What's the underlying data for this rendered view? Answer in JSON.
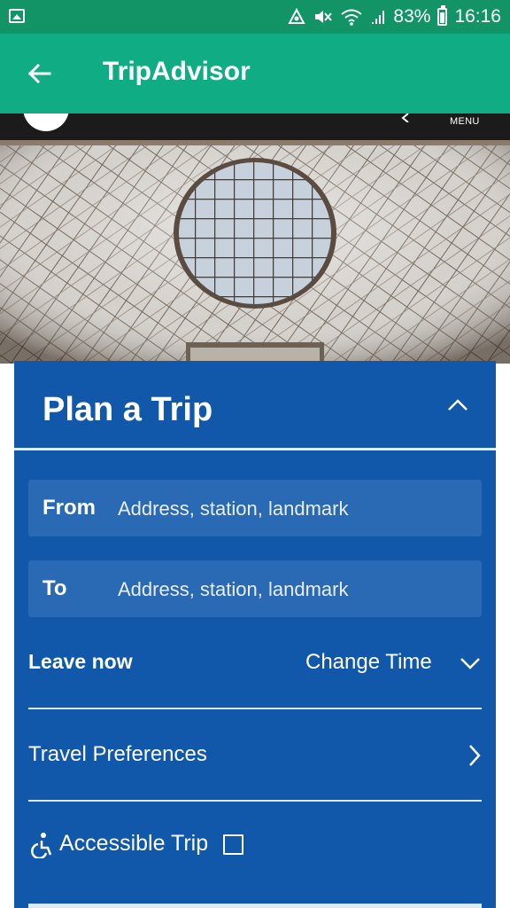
{
  "status_bar": {
    "battery": "83%",
    "time": "16:16"
  },
  "app_bar": {
    "title": "TripAdvisor"
  },
  "site_header": {
    "menu_label": "MENU"
  },
  "plan_trip": {
    "title": "Plan a Trip",
    "from": {
      "label": "From",
      "placeholder": "Address, station, landmark"
    },
    "to": {
      "label": "To",
      "placeholder": "Address, station, landmark"
    },
    "leave_label": "Leave now",
    "change_time_label": "Change Time",
    "travel_preferences_label": "Travel Preferences",
    "accessible_trip_label": "Accessible Trip",
    "accessible_trip_checked": false
  },
  "icons": {
    "status_left": "image-icon",
    "nfc": "nfc-icon",
    "mute": "mute-icon",
    "wifi": "wifi-icon",
    "signal": "signal-icon",
    "battery": "battery-icon",
    "back": "arrow-back-icon",
    "collapse": "chevron-up-icon",
    "change_time": "chevron-down-icon",
    "preferences": "chevron-right-icon",
    "accessible": "wheelchair-icon"
  },
  "colors": {
    "status_bar": "#129467",
    "app_bar": "#10ac84",
    "card": "#1158aa",
    "field": "#2a69b4"
  }
}
